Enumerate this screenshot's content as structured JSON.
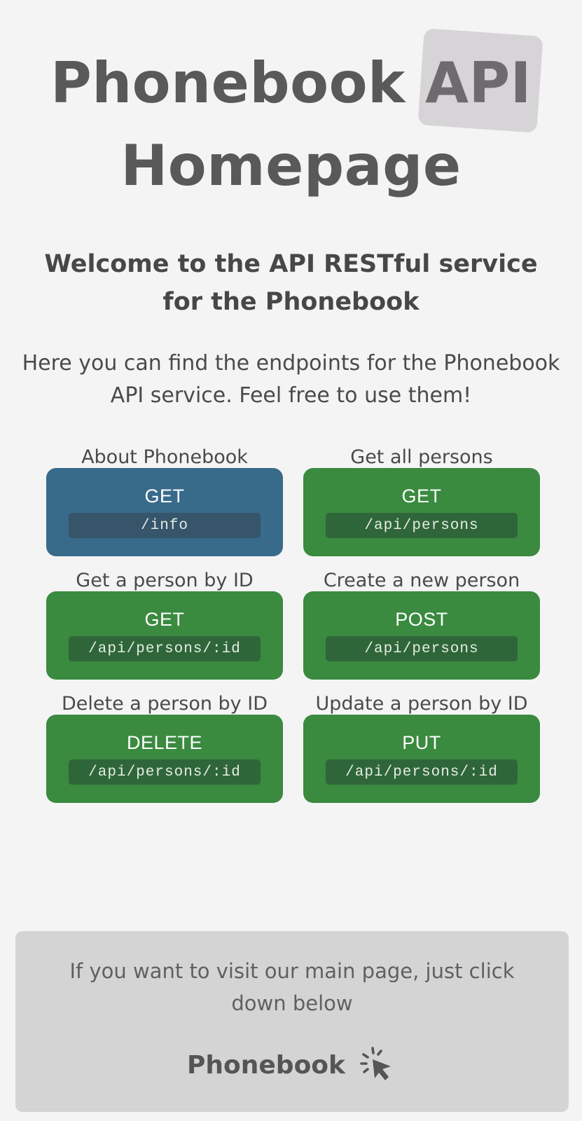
{
  "header": {
    "title_part1": "Phonebook",
    "title_badge": "API",
    "title_part2": "Homepage"
  },
  "welcome": "Welcome to the API RESTful service for the Phonebook",
  "intro": "Here you can find the endpoints for the Phonebook API service. Feel free to use them!",
  "endpoints": [
    {
      "label": "About Phonebook",
      "method": "GET",
      "route": "/info",
      "color": "#386a8a"
    },
    {
      "label": "Get all persons",
      "method": "GET",
      "route": "/api/persons",
      "color": "#3a8a40"
    },
    {
      "label": "Get a person by ID",
      "method": "GET",
      "route": "/api/persons/:id",
      "color": "#3a8a40"
    },
    {
      "label": "Create a new person",
      "method": "POST",
      "route": "/api/persons",
      "color": "#3a8a40"
    },
    {
      "label": "Delete a person by ID",
      "method": "DELETE",
      "route": "/api/persons/:id",
      "color": "#3a8a40"
    },
    {
      "label": "Update a person by ID",
      "method": "PUT",
      "route": "/api/persons/:id",
      "color": "#3a8a40"
    }
  ],
  "footer": {
    "text": "If you want to visit our main page, just click down below",
    "link_label": "Phonebook",
    "link_icon": "cursor-click-icon"
  }
}
